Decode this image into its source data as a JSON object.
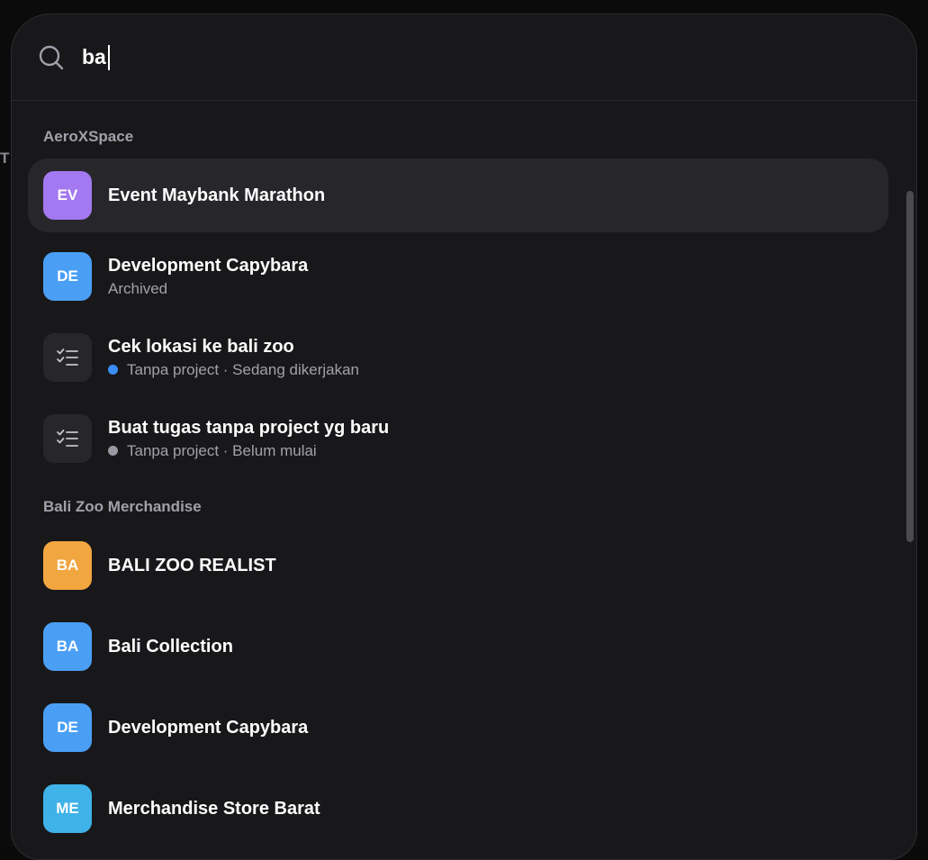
{
  "search": {
    "query": "ba"
  },
  "groups": [
    {
      "label": "AeroXSpace",
      "items": [
        {
          "initials": "EV",
          "title": "Event Maybank Marathon",
          "subtitle": "",
          "color": "#a478f0",
          "type": "project",
          "active": true
        },
        {
          "initials": "DE",
          "title": "Development Capybara",
          "subtitle": "Archived",
          "color": "#4a9ff5",
          "type": "project",
          "active": false
        },
        {
          "initials": "",
          "title": "Cek lokasi ke bali zoo",
          "subtitle": "Tanpa project · Sedang dikerjakan",
          "status_color": "#3b8ef5",
          "type": "task",
          "icon": "checklist-icon",
          "active": false
        },
        {
          "initials": "",
          "title": "Buat tugas tanpa project yg baru",
          "subtitle": "Tanpa project · Belum mulai",
          "status_color": "#9a9aa2",
          "type": "task",
          "icon": "checklist-icon",
          "active": false
        }
      ]
    },
    {
      "label": "Bali Zoo Merchandise",
      "items": [
        {
          "initials": "BA",
          "title": "BALI ZOO REALIST",
          "subtitle": "",
          "color": "#f2a640",
          "type": "project",
          "active": false
        },
        {
          "initials": "BA",
          "title": "Bali Collection",
          "subtitle": "",
          "color": "#4a9ff5",
          "type": "project",
          "active": false
        },
        {
          "initials": "DE",
          "title": "Development Capybara",
          "subtitle": "",
          "color": "#4a9ff5",
          "type": "project",
          "active": false
        },
        {
          "initials": "ME",
          "title": "Merchandise Store Barat",
          "subtitle": "",
          "color": "#3fb2e8",
          "type": "project",
          "active": false
        }
      ]
    }
  ],
  "backdrop": {
    "left_letter": "T"
  }
}
